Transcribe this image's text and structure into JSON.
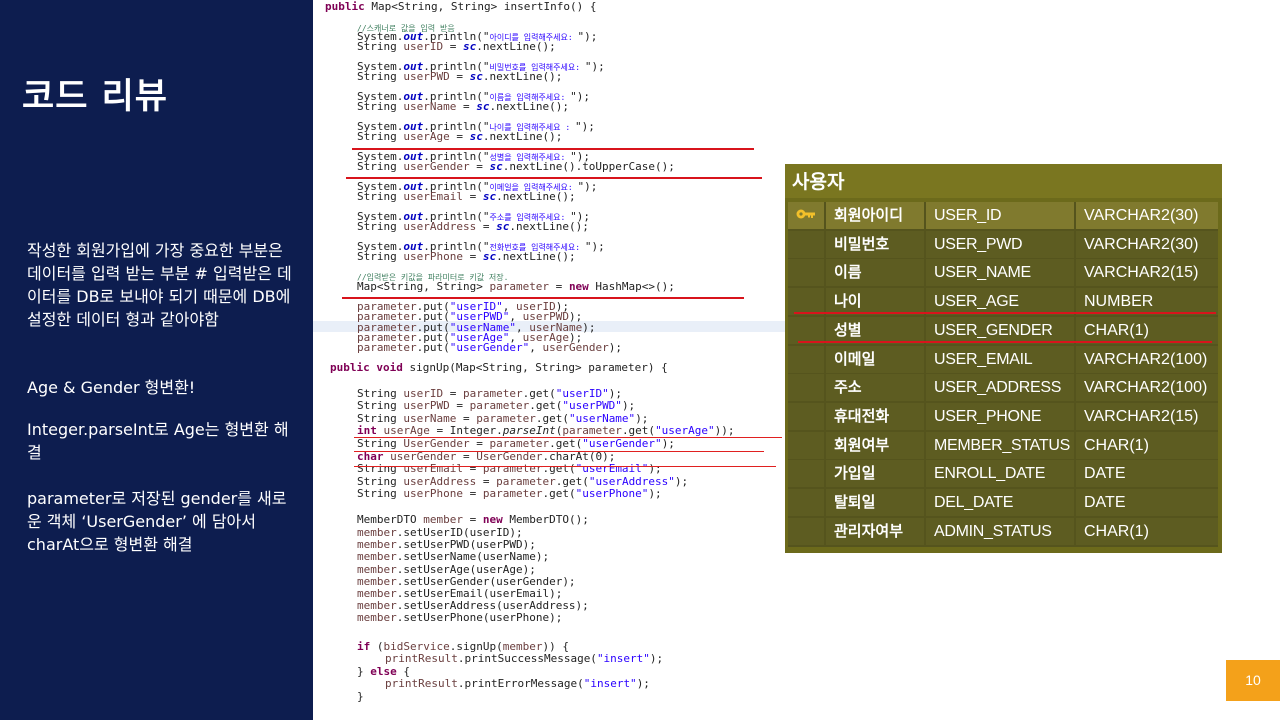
{
  "slide": {
    "title": "코드 리뷰",
    "page_number": "10",
    "notes": [
      "작성한 회원가입에 가장 중요한 부분은 데이터를 입력 받는 부분 # 입력받은 데이터를 DB로 보내야 되기 때문에 DB에 설정한 데이터 형과 같아야함",
      "Age & Gender 형변환!",
      "Integer.parseInt로 Age는 형변환 해결",
      "parameter로 저장된 gender를 새로운 객체 ‘UserGender’ 에 담아서 charAt으로 형변환 해결"
    ]
  },
  "code": {
    "insert_info": {
      "signature": "public Map<String, String> insertInfo() {",
      "comment": "//스캐너로 값을 입력 받음",
      "prompts": [
        {
          "msg": "아이디를 입력해주세요: ",
          "var": "userID"
        },
        {
          "msg": "비밀번호를 입력해주세요: ",
          "var": "userPWD"
        },
        {
          "msg": "이름을 입력해주세요: ",
          "var": "userName"
        },
        {
          "msg": "나이를 입력해주세요 : ",
          "var": "userAge"
        },
        {
          "msg": "성별을 입력해주세요: ",
          "var": "userGender"
        },
        {
          "msg": "이메일을 입력해주세요: ",
          "var": "userEmail"
        },
        {
          "msg": "주소를 입력해주세요: ",
          "var": "userAddress"
        },
        {
          "msg": "전화번호를 입력해주세요: ",
          "var": "userPhone"
        }
      ],
      "gender_read_suffix": ".nextLine().toUpperCase();",
      "default_read_suffix": ".nextLine();",
      "comment2": "//입력받은 키값을 파라미터로 키값 저장.",
      "map_line": "Map<String, String> parameter = new HashMap<>();",
      "put_lines": [
        {
          "key": "\"userID\"",
          "val": "userID);"
        },
        {
          "key": "\"userPWD\"",
          "val": "userPWD);"
        },
        {
          "key": "\"userName\"",
          "val": "userName);"
        },
        {
          "key": "\"userAge\"",
          "val": "userAge);"
        },
        {
          "key": "\"userGender\"",
          "val": "userGender);"
        }
      ]
    },
    "sign_up": {
      "signature": "public void signUp(Map<String, String> parameter) {",
      "gets": [
        {
          "type": "String",
          "var": "userID",
          "key": "\"userID\""
        },
        {
          "type": "String",
          "var": "userPWD",
          "key": "\"userPWD\""
        },
        {
          "type": "String",
          "var": "userName",
          "key": "\"userName\""
        }
      ],
      "age_line": {
        "pre": "int userAge = Integer.",
        "method": "parseInt",
        "post": "(parameter.get(",
        "key": "\"userAge\"",
        "end": "));"
      },
      "usergender_line": {
        "pre": "String UserGender = parameter.get(",
        "key": "\"userGender\"",
        "end": ");"
      },
      "char_line": {
        "kw": "char",
        "rest": " userGender = UserGender.charAt(0);"
      },
      "gets2": [
        {
          "type": "String",
          "var": "userEmail",
          "key": "\"userEmail\""
        },
        {
          "type": "String",
          "var": "userAddress",
          "key": "\"userAddress\""
        },
        {
          "type": "String",
          "var": "userPhone",
          "key": "\"userPhone\""
        }
      ],
      "member_new": "MemberDTO member = new MemberDTO();",
      "setters": [
        "member.setUserID(userID);",
        "member.setUserPWD(userPWD);",
        "member.setUserName(userName);",
        "member.setUserAge(userAge);",
        "member.setUserGender(userGender);",
        "member.setUserEmail(userEmail);",
        "member.setUserAddress(userAddress);",
        "member.setUserPhone(userPhone);"
      ],
      "if_line": "if (bidService.signUp(member)) {",
      "success_line": "printResult.printSuccessMessage(\"insert\");",
      "else_line": "} else {",
      "error_line": "printResult.printErrorMessage(\"insert\");",
      "close_brace": "}"
    }
  },
  "db_table": {
    "title": "사용자",
    "key_icon": "key-icon",
    "rows": [
      {
        "label": "회원아이디",
        "column": "USER_ID",
        "type": "VARCHAR2(30)"
      },
      {
        "label": "비밀번호",
        "column": "USER_PWD",
        "type": "VARCHAR2(30)"
      },
      {
        "label": "이름",
        "column": "USER_NAME",
        "type": "VARCHAR2(15)"
      },
      {
        "label": "나이",
        "column": "USER_AGE",
        "type": "NUMBER"
      },
      {
        "label": "성별",
        "column": "USER_GENDER",
        "type": "CHAR(1)"
      },
      {
        "label": "이메일",
        "column": "USER_EMAIL",
        "type": "VARCHAR2(100)"
      },
      {
        "label": "주소",
        "column": "USER_ADDRESS",
        "type": "VARCHAR2(100)"
      },
      {
        "label": "휴대전화",
        "column": "USER_PHONE",
        "type": "VARCHAR2(15)"
      },
      {
        "label": "회원여부",
        "column": "MEMBER_STATUS",
        "type": "CHAR(1)"
      },
      {
        "label": "가입일",
        "column": "ENROLL_DATE",
        "type": "DATE"
      },
      {
        "label": "탈퇴일",
        "column": "DEL_DATE",
        "type": "DATE"
      },
      {
        "label": "관리자여부",
        "column": "ADMIN_STATUS",
        "type": "CHAR(1)"
      }
    ]
  },
  "colors": {
    "panel": "#0d1d4f",
    "accent_red": "#d8141c",
    "page_badge": "#f4a11a",
    "table_bg": "#6c6a1b"
  }
}
